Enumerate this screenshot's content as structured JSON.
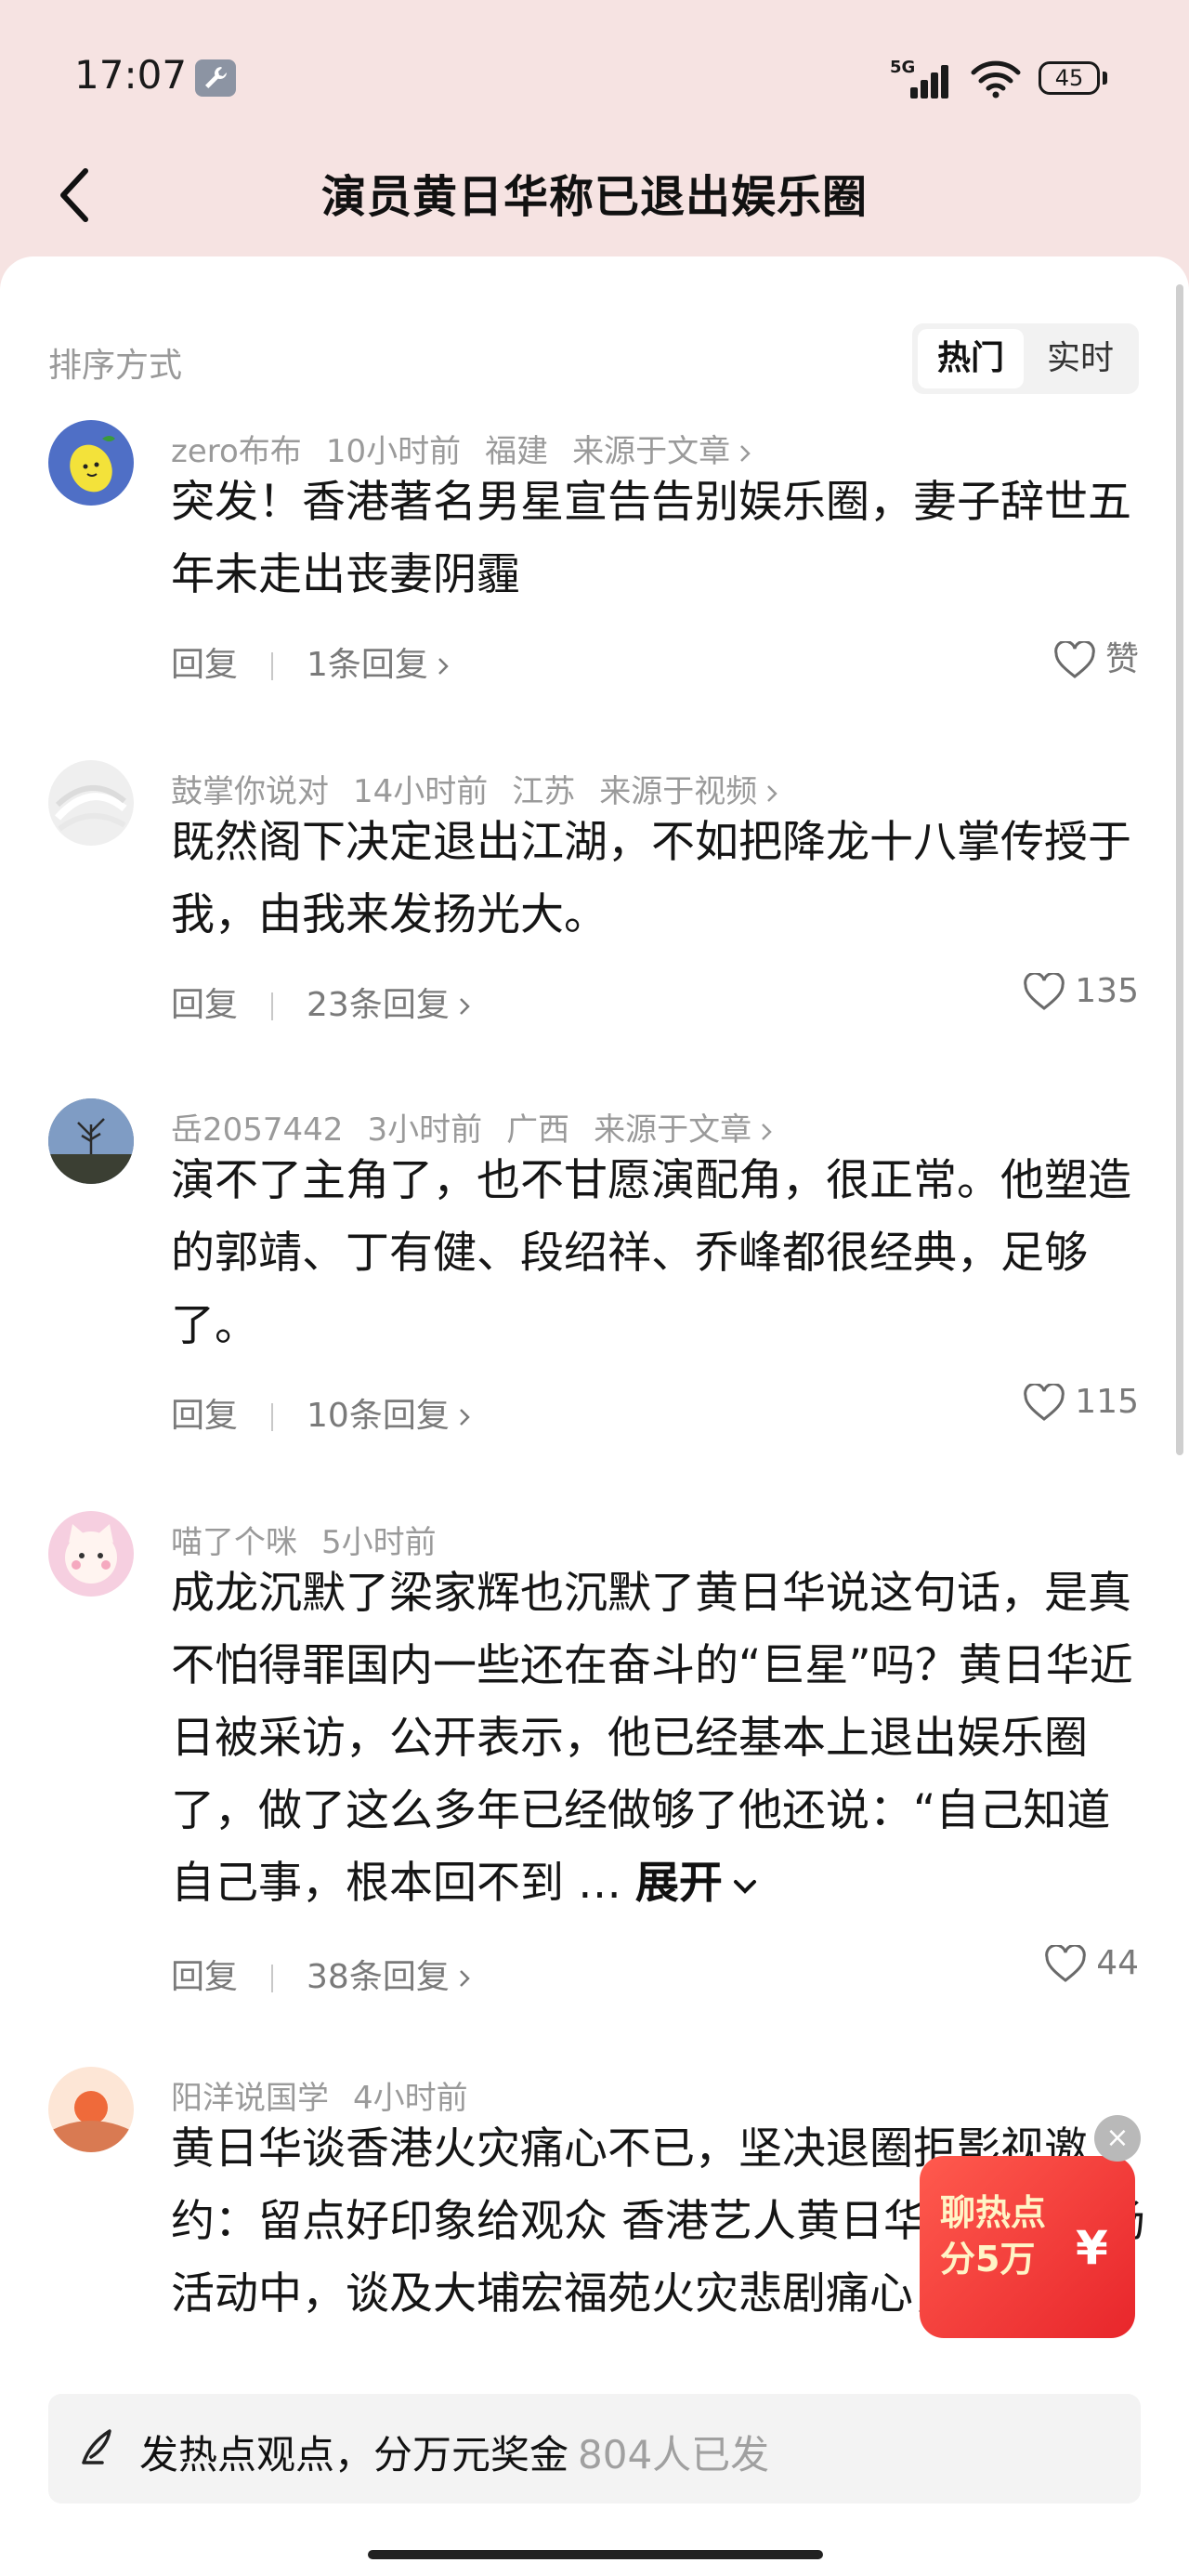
{
  "status_bar": {
    "time": "17:07",
    "network": "5G",
    "battery": "45"
  },
  "header": {
    "title": "演员黄日华称已退出娱乐圈"
  },
  "sort": {
    "label": "排序方式",
    "options": [
      "热门",
      "实时"
    ],
    "selected": "热门"
  },
  "comments": [
    {
      "user": "zero布布",
      "time": "10小时前",
      "location": "福建",
      "source": "来源于文章",
      "text": "突发！香港著名男星宣告告别娱乐圈，妻子辞世五年未走出丧妻阴霾",
      "reply": "回复",
      "replies": "1条回复",
      "likes": "赞"
    },
    {
      "user": "鼓掌你说对",
      "time": "14小时前",
      "location": "江苏",
      "source": "来源于视频",
      "text": "既然阁下决定退出江湖，不如把降龙十八掌传授于我，由我来发扬光大。",
      "reply": "回复",
      "replies": "23条回复",
      "likes": "135"
    },
    {
      "user": "岳2057442",
      "time": "3小时前",
      "location": "广西",
      "source": "来源于文章",
      "text": "演不了主角了，也不甘愿演配角，很正常。他塑造的郭靖、丁有健、段绍祥、乔峰都很经典，足够了。",
      "reply": "回复",
      "replies": "10条回复",
      "likes": "115"
    },
    {
      "user": "喵了个咪",
      "time": "5小时前",
      "text": "成龙沉默了梁家辉也沉默了黄日华说这句话，是真不怕得罪国内一些还在奋斗的“巨星”吗？黄日华近日被采访，公开表示，他已经基本上退出娱乐圈了，做了这么多年已经做够了他还说：“自己知道自己事，根本回不到 …",
      "expand": "展开",
      "reply": "回复",
      "replies": "38条回复",
      "likes": "44"
    },
    {
      "user": "阳洋说国学",
      "time": "4小时前",
      "text": "黄日华谈香港火灾痛心不已，坚决退圈拒影视邀约：留点好印象给观众 香港艺人黄日华近日在一场活动中，谈及大埔宏福苑火灾悲剧痛心，他住在大埔，每次出门回家都必经宏"
    }
  ],
  "promo": {
    "line1": "聊热点",
    "line2": "分5万",
    "symbol": "¥",
    "close": "×"
  },
  "bottom_bar": {
    "prompt": "发热点观点，分万元奖金",
    "count": "804人已发"
  },
  "colors": {
    "header_bg": "#f6e3e2",
    "panel_bg": "#ffffff",
    "promo_red": "#e8262b"
  },
  "icons": [
    "wrench-icon",
    "signal-icon",
    "wifi-icon",
    "battery-icon",
    "back-arrow-icon",
    "chevron-right-icon",
    "heart-icon",
    "chevron-down-icon",
    "pen-icon",
    "close-icon"
  ]
}
